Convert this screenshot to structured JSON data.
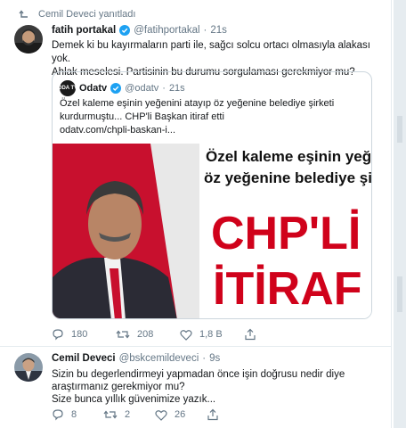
{
  "retweet_context": {
    "label": "Cemil Deveci yanıtladı",
    "icon": "retweet-context-icon"
  },
  "tweet1": {
    "author_name": "fatih portakal",
    "handle": "@fatihportakal",
    "dot": "·",
    "time": "21s",
    "text_line1": "Demek ki bu kayırmaların parti ile, sağcı solcu ortacı olmasıyla alakası yok.",
    "text_line2": "Ahlak meselesi. Partisinin bu durumu sorgulaması gerekmiyor mu?",
    "quote": {
      "logo_text": "ODA TV",
      "author_name": "Odatv",
      "handle": "@odatv",
      "dot": "·",
      "time": "21s",
      "text_line1": "Özel kaleme eşinin yeğenini atayıp öz yeğenine belediye şirketi",
      "text_line2": "kurdurmuştu... CHP'li Başkan itiraf etti",
      "link": "odatv.com/chpli-baskan-i...",
      "image_headline1": "Özel kaleme eşinin yeğeni",
      "image_headline2": "öz yeğenine belediye şirketi k",
      "image_big1": "CHP'Lİ BAŞ",
      "image_big2": "İTİRAF E"
    },
    "actions": {
      "reply_count": "180",
      "retweet_count": "208",
      "like_count": "1,8 B"
    }
  },
  "tweet2": {
    "author_name": "Cemil Deveci",
    "handle": "@bskcemildeveci",
    "dot": "·",
    "time": "9s",
    "text_line1": "Sizin bu degerlendirmeyi yapmadan önce işin doğrusu nedir diye",
    "text_line2": "araştırmanız gerekmiyor mu?",
    "text_line3": "Size bunca yıllık güvenimize yazık...",
    "actions": {
      "reply_count": "8",
      "retweet_count": "2",
      "like_count": "26"
    }
  },
  "colors": {
    "accent": "#1da1f2",
    "muted": "#657786",
    "border": "#ccd6dd",
    "headline_red": "#d0021b"
  }
}
